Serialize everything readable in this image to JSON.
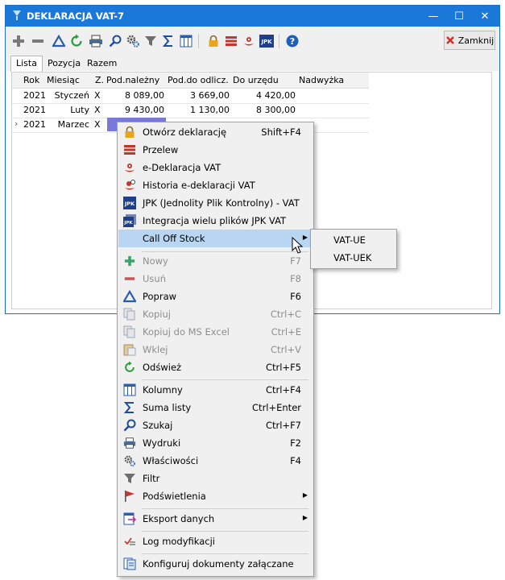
{
  "window": {
    "title": "DEKLARACJA VAT-7",
    "minimize": "—",
    "maximize": "☐",
    "close": "✕"
  },
  "toolbar": {
    "close_label": "Zamknij",
    "icons": [
      "plus-icon",
      "minus-icon",
      "edit-triangle-icon",
      "refresh-icon",
      "printer-icon",
      "search-icon",
      "gear-icon",
      "filter-icon",
      "sigma-icon",
      "columns-icon",
      "lock-icon",
      "transfer-icon",
      "e-declaration-icon",
      "jpk-icon",
      "help-icon"
    ]
  },
  "tabs": [
    {
      "label": "Lista"
    },
    {
      "label": "Pozycja"
    },
    {
      "label": "Razem"
    }
  ],
  "table": {
    "columns": [
      "Rok",
      "Miesiąc",
      "Z.",
      "Pod.należny",
      "Pod.do odlicz.",
      "Do urzędu",
      "Nadwyżka"
    ],
    "rows": [
      {
        "rok": "2021",
        "miesiac": "Styczeń",
        "z": "X",
        "nalezny": "8 089,00",
        "odlicz": "3 669,00",
        "urzad": "4 420,00",
        "nadwyzka": ""
      },
      {
        "rok": "2021",
        "miesiac": "Luty",
        "z": "X",
        "nalezny": "9 430,00",
        "odlicz": "1 130,00",
        "urzad": "8 300,00",
        "nadwyzka": ""
      },
      {
        "rok": "2021",
        "miesiac": "Marzec",
        "z": "X",
        "nalezny": "",
        "odlicz": "",
        "urzad": "",
        "nadwyzka": ""
      }
    ]
  },
  "context_menu": {
    "items": [
      {
        "label": "Otwórz deklarację",
        "shortcut": "Shift+F4"
      },
      {
        "label": "Przelew",
        "shortcut": ""
      },
      {
        "label": "e-Deklaracja VAT",
        "shortcut": ""
      },
      {
        "label": "Historia e-deklaracji VAT",
        "shortcut": ""
      },
      {
        "label": "JPK (Jednolity Plik Kontrolny) - VAT",
        "shortcut": ""
      },
      {
        "label": "Integracja wielu plików JPK VAT",
        "shortcut": ""
      },
      {
        "label": "Call Off Stock",
        "shortcut": ""
      },
      {
        "label": "Nowy",
        "shortcut": "F7"
      },
      {
        "label": "Usuń",
        "shortcut": "F8"
      },
      {
        "label": "Popraw",
        "shortcut": "F6"
      },
      {
        "label": "Kopiuj",
        "shortcut": "Ctrl+C"
      },
      {
        "label": "Kopiuj do MS Excel",
        "shortcut": "Ctrl+E"
      },
      {
        "label": "Wklej",
        "shortcut": "Ctrl+V"
      },
      {
        "label": "Odśwież",
        "shortcut": "Ctrl+F5"
      },
      {
        "label": "Kolumny",
        "shortcut": "Ctrl+F4"
      },
      {
        "label": "Suma listy",
        "shortcut": "Ctrl+Enter"
      },
      {
        "label": "Szukaj",
        "shortcut": "Ctrl+F7"
      },
      {
        "label": "Wydruki",
        "shortcut": "F2"
      },
      {
        "label": "Właściwości",
        "shortcut": "F4"
      },
      {
        "label": "Filtr",
        "shortcut": ""
      },
      {
        "label": "Podświetlenia",
        "shortcut": ""
      },
      {
        "label": "Eksport danych",
        "shortcut": ""
      },
      {
        "label": "Log modyfikacji",
        "shortcut": ""
      },
      {
        "label": "Konfiguruj dokumenty załączane",
        "shortcut": ""
      }
    ]
  },
  "submenu": {
    "items": [
      {
        "label": "VAT-UE"
      },
      {
        "label": "VAT-UEK"
      }
    ]
  },
  "colors": {
    "titlebar": "#1a78d8",
    "highlight": "#b8d6f2",
    "selected_cell": "#7a78d9"
  }
}
